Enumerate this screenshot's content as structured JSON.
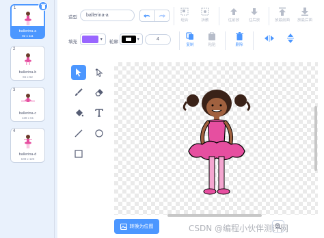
{
  "costumes": [
    {
      "num": "1",
      "name": "ballerina-a",
      "size": "82 x 111",
      "selected": true
    },
    {
      "num": "2",
      "name": "ballerina-b",
      "size": "66 x 62",
      "selected": false
    },
    {
      "num": "3",
      "name": "ballerina-c",
      "size": "128 x 61",
      "selected": false
    },
    {
      "num": "4",
      "name": "ballerina-d",
      "size": "108 x 123",
      "selected": false
    }
  ],
  "toolbar": {
    "costume_label": "造型",
    "costume_name": "ballerina-a",
    "fill_label": "填充",
    "outline_label": "轮廓",
    "outline_width": "4",
    "fill_color": "#9966ff",
    "outline_color": "#000000",
    "group": "组合",
    "ungroup": "拆散",
    "forward": "往前放",
    "backward": "往后放",
    "front": "放最前面",
    "back": "放最后面",
    "copy": "复制",
    "paste": "粘贴",
    "delete": "删除"
  },
  "convert_label": "转换为位图",
  "watermark": "CSDN @编程小伙伴测评网",
  "colors": {
    "accent": "#4c97ff",
    "text": "#575e75",
    "disabled": "#b6bcc9"
  }
}
